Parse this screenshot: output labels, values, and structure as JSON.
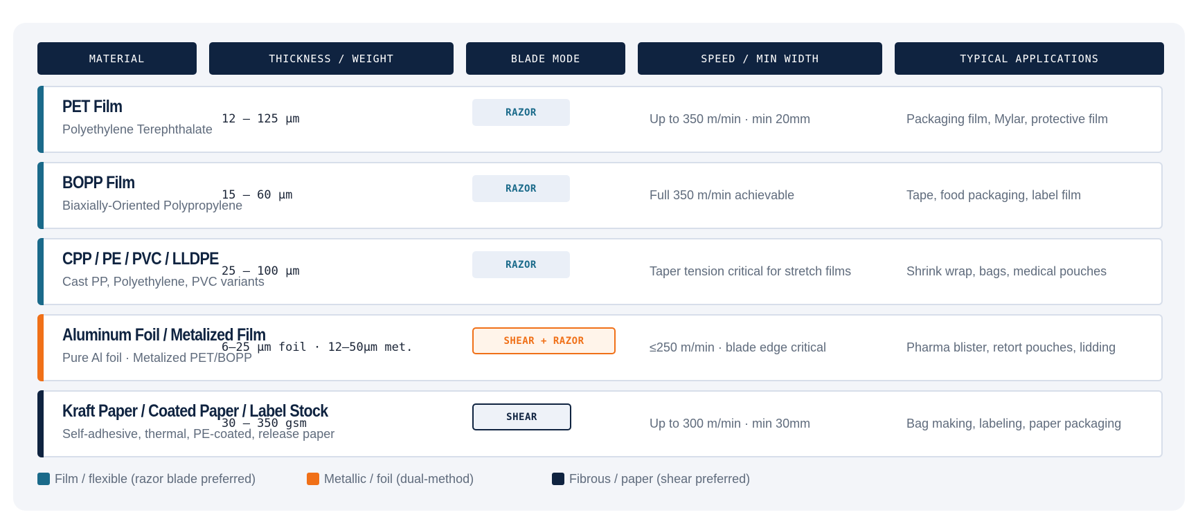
{
  "colors": {
    "film": "#1a6a8a",
    "metallic": "#f07018",
    "fibrous": "#0f2340",
    "header_bg": "#0f2340"
  },
  "headers": [
    "MATERIAL",
    "THICKNESS / WEIGHT",
    "BLADE MODE",
    "SPEED / MIN WIDTH",
    "TYPICAL APPLICATIONS"
  ],
  "rows": [
    {
      "title": "PET Film",
      "subtitle": "Polyethylene Terephthalate",
      "thickness": "12 – 125 μm",
      "blade": "RAZOR",
      "blade_style": "razor",
      "category": "film",
      "speed": "Up to 350 m/min · min 20mm",
      "apps": "Packaging film, Mylar, protective film"
    },
    {
      "title": "BOPP Film",
      "subtitle": "Biaxially-Oriented Polypropylene",
      "thickness": "15 – 60 μm",
      "blade": "RAZOR",
      "blade_style": "razor",
      "category": "film",
      "speed": "Full 350 m/min achievable",
      "apps": "Tape, food packaging, label film"
    },
    {
      "title": "CPP / PE / PVC / LLDPE",
      "subtitle": "Cast PP, Polyethylene, PVC variants",
      "thickness": "25 – 100 μm",
      "blade": "RAZOR",
      "blade_style": "razor",
      "category": "film",
      "speed": "Taper tension critical for stretch films",
      "apps": "Shrink wrap, bags, medical pouches"
    },
    {
      "title": "Aluminum Foil / Metalized Film",
      "subtitle": "Pure Al foil · Metalized PET/BOPP",
      "thickness": "6–25 μm foil · 12–50μm met.",
      "blade": "SHEAR + RAZOR",
      "blade_style": "shear-razor",
      "category": "metallic",
      "speed": "≤250 m/min · blade edge critical",
      "apps": "Pharma blister, retort pouches, lidding"
    },
    {
      "title": "Kraft Paper / Coated Paper / Label Stock",
      "subtitle": "Self-adhesive, thermal, PE-coated, release paper",
      "thickness": "30 – 350 gsm",
      "blade": "SHEAR",
      "blade_style": "shear",
      "category": "fibrous",
      "speed": "Up to 300 m/min · min 30mm",
      "apps": "Bag making, labeling, paper packaging"
    }
  ],
  "legend": [
    {
      "label": "Film / flexible (razor blade preferred)",
      "category": "film"
    },
    {
      "label": "Metallic / foil (dual-method)",
      "category": "metallic"
    },
    {
      "label": "Fibrous / paper (shear preferred)",
      "category": "fibrous"
    }
  ]
}
